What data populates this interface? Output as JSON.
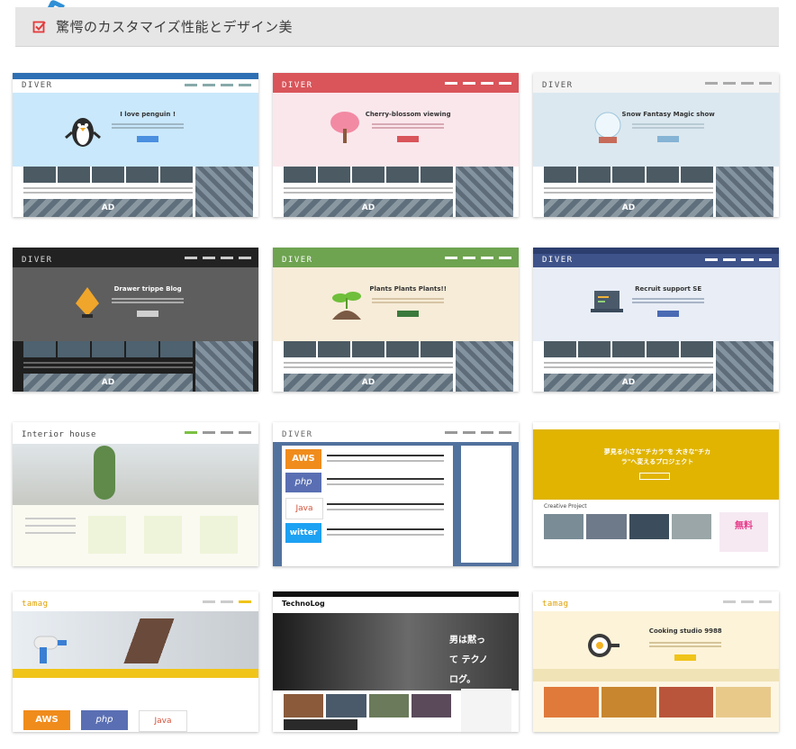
{
  "heading": {
    "text": "驚愕のカスタマイズ性能とデザイン美",
    "check_icon": "checkbox-check-icon",
    "accent_color": "#e6393a"
  },
  "thumbnails": [
    {
      "logo": "DIVER",
      "title": "I love penguin !",
      "ad": "AD"
    },
    {
      "logo": "DIVER",
      "title": "Cherry-blossom viewing",
      "ad": "AD"
    },
    {
      "logo": "DIVER",
      "title": "Snow Fantasy Magic show",
      "ad": "AD"
    },
    {
      "logo": "DIVER",
      "title": "Drawer trippe Blog",
      "ad": "AD"
    },
    {
      "logo": "DIVER",
      "title": "Plants Plants Plants!!",
      "ad": "AD"
    },
    {
      "logo": "DIVER",
      "title": "Recruit support SE",
      "ad": "AD"
    },
    {
      "logo": "Interior house",
      "title": ""
    },
    {
      "logo": "DIVER",
      "title": ""
    },
    {
      "logo": "",
      "title": "夢見る小さな\"チカラ\"を 大きな\"チカラ\"へ変えるプロジェクト",
      "sub": "Creative Project",
      "sub2": "無料"
    },
    {
      "logo": "tamag",
      "title": ""
    },
    {
      "logo": "TechnoLog",
      "title": "男は黙って テクノログ。"
    },
    {
      "logo": "tamag",
      "title": "Cooking studio 9988"
    }
  ],
  "labels": {
    "aws": "AWS",
    "php": "php",
    "java": "Java",
    "twitter": "witter"
  },
  "colors": {
    "blue_hero": "#c9e8fb",
    "pink_hero": "#fae7ec",
    "red_header": "#d9555a",
    "gray_header": "#f4f4f4",
    "dark_header": "#222222",
    "green_header": "#6ea350",
    "navy_header": "#3e538a",
    "yellow": "#e0b400"
  }
}
